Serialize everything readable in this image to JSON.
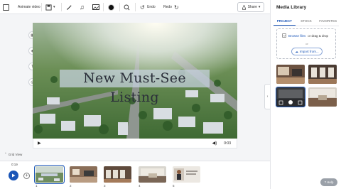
{
  "toolbar": {
    "animate_label": "Animate video",
    "undo_label": "Undo",
    "redo_label": "Redo",
    "share_label": "Share"
  },
  "canvas": {
    "title_text": "New Must-See Listing",
    "time_display": "0:03"
  },
  "grid_view_label": "Grid View",
  "timeline": {
    "current_time": "0:19",
    "clips": [
      {
        "number": "1",
        "selected": true
      },
      {
        "number": "2",
        "selected": false
      },
      {
        "number": "3",
        "selected": false
      },
      {
        "number": "4",
        "selected": false
      },
      {
        "number": "5",
        "selected": false
      }
    ]
  },
  "sidebar": {
    "title": "Media Library",
    "tabs": [
      "PROJECT",
      "STOCK",
      "FAVORITES"
    ],
    "active_tab": "PROJECT",
    "upload": {
      "browse_link": "Browse files",
      "browse_suffix": "or drag & drop",
      "or_text": "or",
      "import_label": "Import from..."
    }
  },
  "help_label": "Help",
  "colors": {
    "accent": "#1a55b7",
    "title_band": "#c8d2e1"
  }
}
